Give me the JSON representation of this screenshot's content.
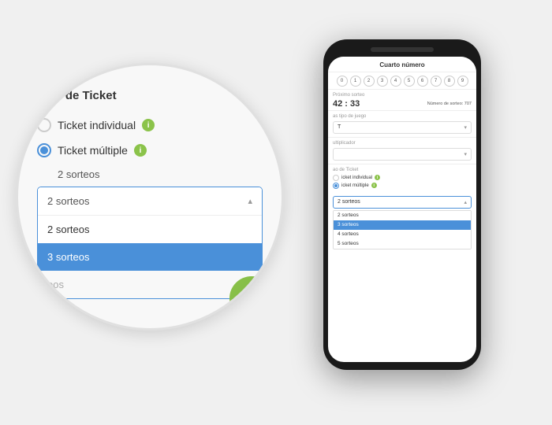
{
  "phone": {
    "header_title": "Cuarto número",
    "digits": [
      "0",
      "1",
      "2",
      "3",
      "4",
      "5",
      "6",
      "7",
      "8",
      "9"
    ],
    "sorteo_label": "Próximo sorteo",
    "timer": "42 : 33",
    "numero_label": "Número de sorteo: 707",
    "juego_label": "as tipo de juego",
    "juego_placeholder": "T",
    "multiplicador_label": "ultiplicador",
    "tipo_ticket_label": "ao de Ticket",
    "ticket_individual": "icket individual",
    "ticket_multiple": "icket múltiple",
    "sorteos_value": "2 sorteos",
    "dropdown_value": "2 sorteos",
    "option_2": "2 sorteos",
    "option_3": "3 sorteos",
    "option_4": "4 sorteos",
    "option_5": "5 sorteos"
  },
  "magnifier": {
    "title": "tipo de Ticket",
    "ticket_individual_label": "Ticket individual",
    "ticket_multiple_label": "Ticket múltiple",
    "sorteos_label": "2 sorteos",
    "dropdown_value": "2 sorteos",
    "option_1": "2 sorteos",
    "option_2": "3 sorteos",
    "option_3_ghost": "eos"
  }
}
